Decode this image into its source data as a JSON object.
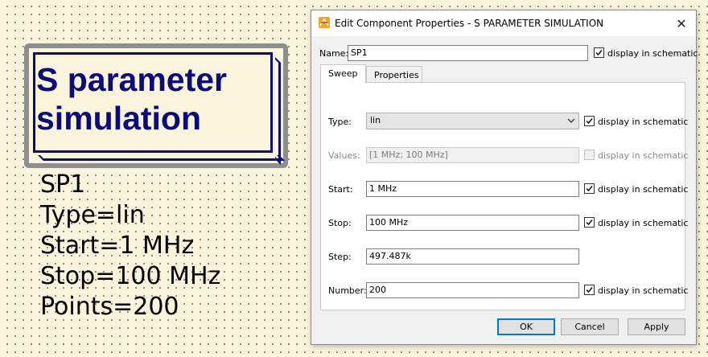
{
  "schematic": {
    "component_title": "S parameter\nsimulation",
    "params": [
      "SP1",
      "Type=lin",
      "Start=1 MHz",
      "Stop=100 MHz",
      "Points=200"
    ]
  },
  "dialog": {
    "title": "Edit Component Properties - S PARAMETER SIMULATION",
    "close_glyph": "✕",
    "name_label": "Name:",
    "name_value": "SP1",
    "display_label": "display in schematic",
    "tabs": [
      "Sweep",
      "Properties"
    ],
    "active_tab": "Sweep",
    "fields": {
      "type": {
        "label": "Type:",
        "value": "lin",
        "display_checked": true
      },
      "values": {
        "label": "Values:",
        "value": "[1 MHz; 100 MHz]",
        "display_checked": false,
        "disabled": true
      },
      "start": {
        "label": "Start:",
        "value": "1 MHz",
        "display_checked": true
      },
      "stop": {
        "label": "Stop:",
        "value": "100 MHz",
        "display_checked": true
      },
      "step": {
        "label": "Step:",
        "value": "497.487k"
      },
      "number": {
        "label": "Number:",
        "value": "200",
        "display_checked": true
      }
    },
    "buttons": {
      "ok": "OK",
      "cancel": "Cancel",
      "apply": "Apply"
    }
  },
  "icons": {
    "app": "qucs-app-icon",
    "checkmark": "checkmark-icon",
    "dropdown": "chevron-down-icon",
    "close": "close-icon"
  },
  "colors": {
    "component_blue": "#0b0b7c",
    "component_frame": "#8e8e8e",
    "canvas_bg": "#fbf4dc",
    "dialog_bg": "#f0f0f0",
    "focus_blue": "#0078d7"
  }
}
